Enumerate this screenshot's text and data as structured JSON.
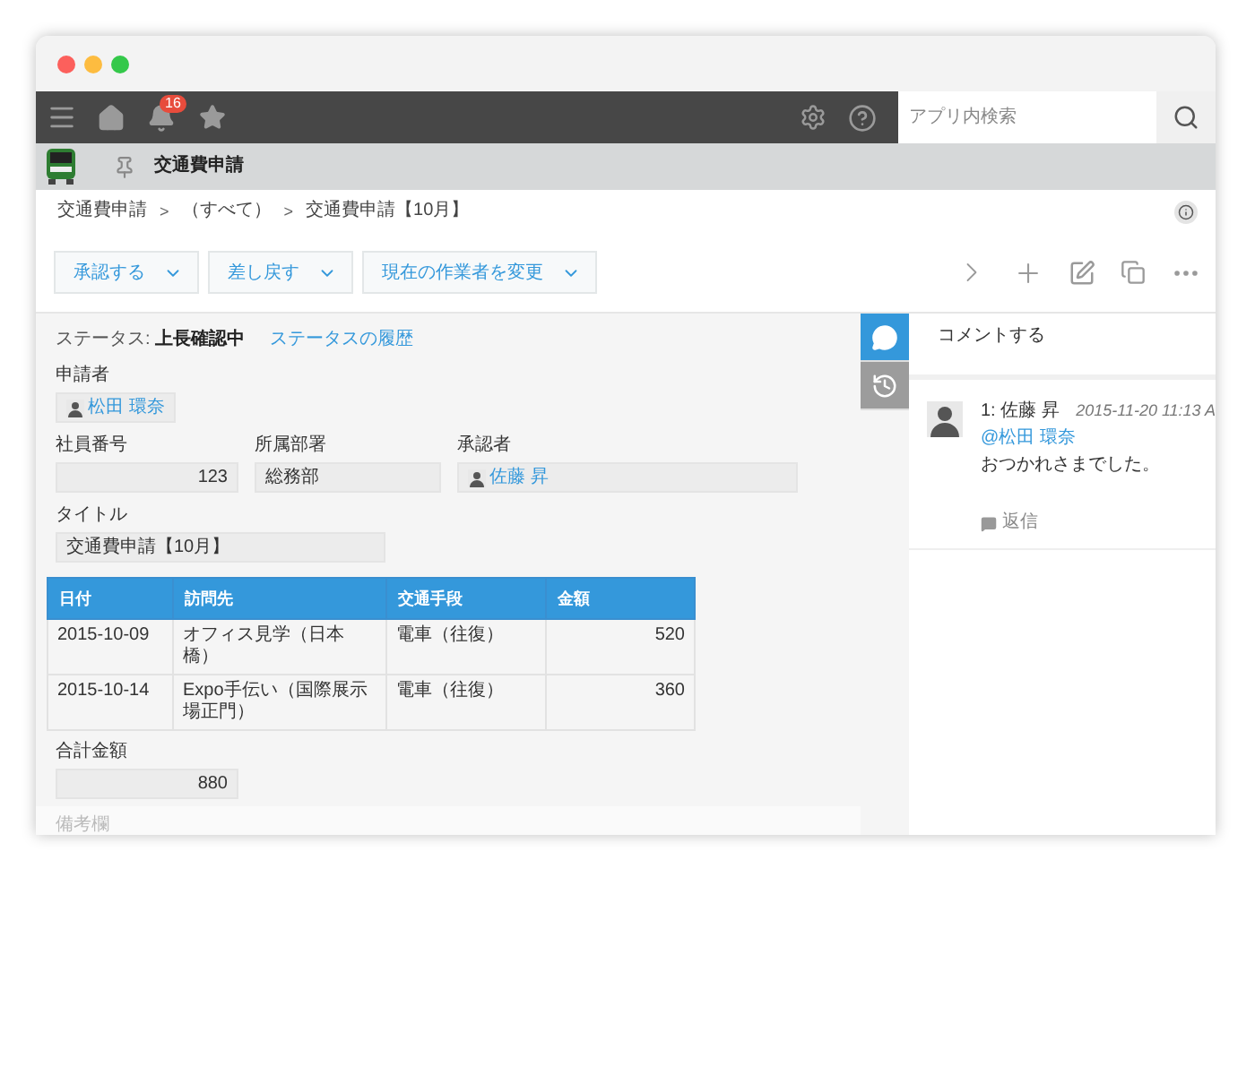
{
  "nav": {
    "notification_count": "16",
    "search": {
      "placeholder": "アプリ内検索"
    }
  },
  "app": {
    "name": "交通費申請"
  },
  "breadcrumb": {
    "separator": ">",
    "items": [
      "交通費申請",
      "（すべて）",
      "交通費申請【10月】"
    ]
  },
  "actions": [
    "承認する",
    "差し戻す",
    "現在の作業者を変更"
  ],
  "status": {
    "label": "ステータス:",
    "value": "上長確認中",
    "history_link": "ステータスの履歴"
  },
  "field_rows": [
    [
      {
        "label": "申請者",
        "kind": "user",
        "value": "松田 環奈"
      }
    ],
    [
      {
        "label": "社員番号",
        "kind": "number",
        "value": "123"
      },
      {
        "label": "所属部署",
        "kind": "text",
        "value": "総務部"
      },
      {
        "label": "承認者",
        "kind": "user",
        "value": "佐藤 昇"
      }
    ],
    [
      {
        "label": "タイトル",
        "kind": "text",
        "value": "交通費申請【10月】"
      }
    ]
  ],
  "table": {
    "columns": [
      "日付",
      "訪問先",
      "交通手段",
      "金額"
    ],
    "rows": [
      [
        "2015-10-09",
        "オフィス見学（日本橋）",
        "電車（往復）",
        "520"
      ],
      [
        "2015-10-14",
        "Expo手伝い（国際展示場正門）",
        "電車（往復）",
        "360"
      ]
    ]
  },
  "total": {
    "label": "合計金額",
    "value": "880"
  },
  "remarks": {
    "label": "備考欄"
  },
  "side_tabs": [
    {
      "kind": "comments",
      "selected": true
    },
    {
      "kind": "history",
      "selected": false
    }
  ],
  "comments": {
    "prompt": "コメントする",
    "items": [
      {
        "number": "1:",
        "author": "佐藤 昇",
        "time": "2015-11-20 11:13 A",
        "mention": "@松田 環奈",
        "body": "おつかれさまでした。",
        "reply": "返信"
      }
    ]
  }
}
